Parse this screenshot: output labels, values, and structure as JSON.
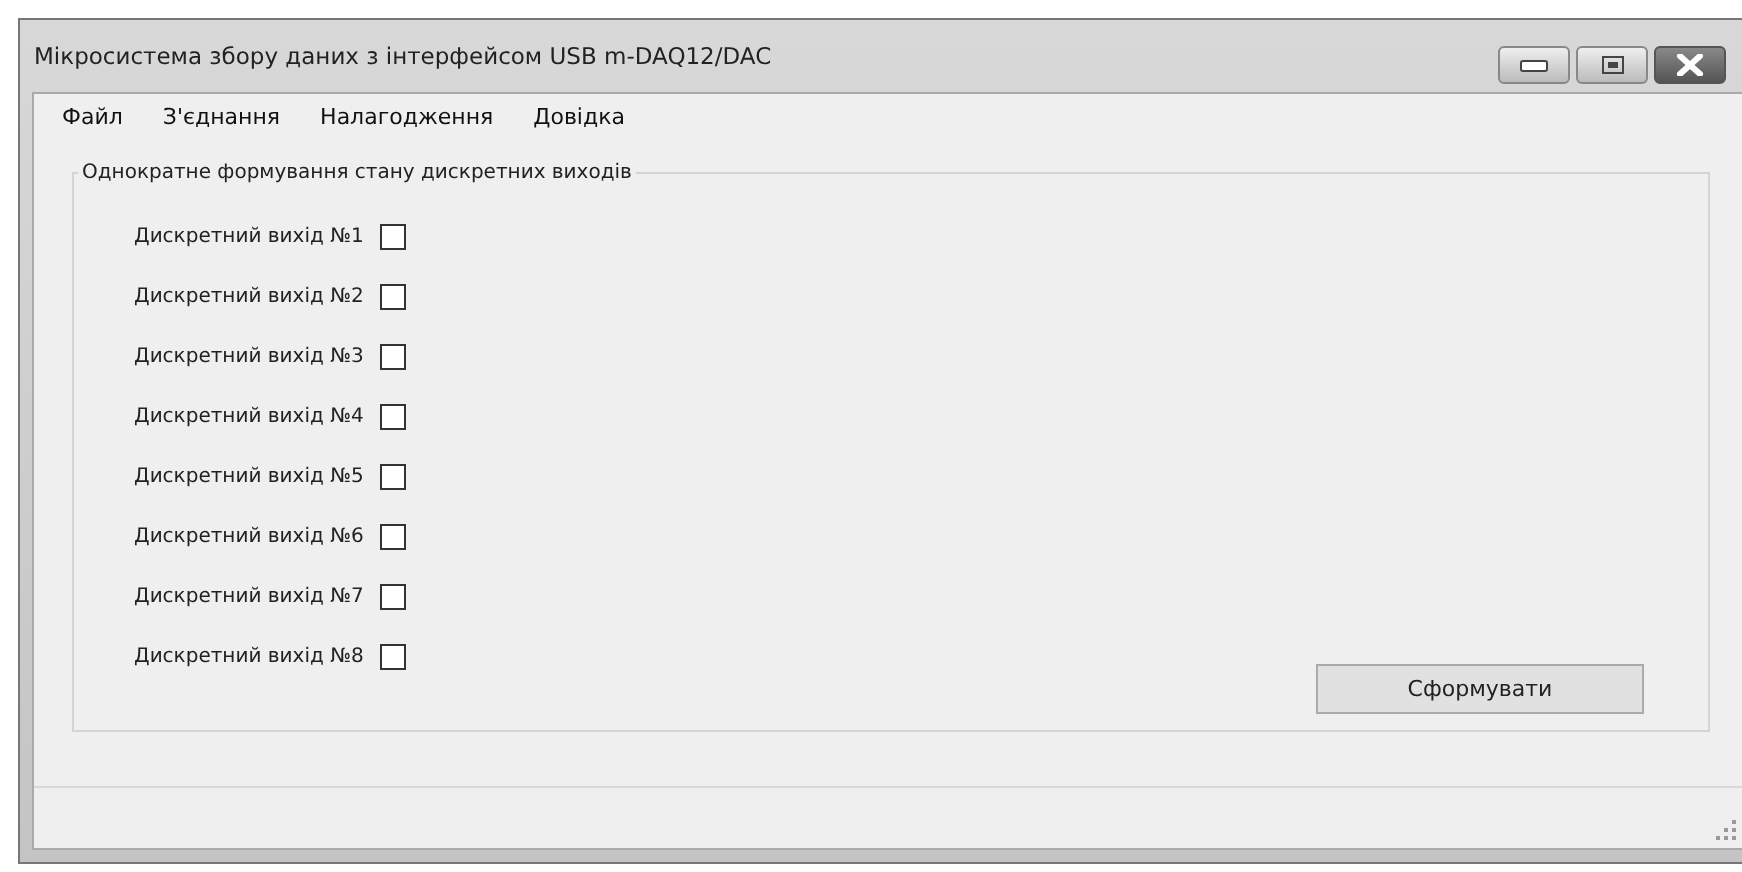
{
  "window": {
    "title": "Мікросистема збору даних з інтерфейсом USB m-DAQ12/DAC"
  },
  "menu": [
    "Файл",
    "З'єднання",
    "Налагодження",
    "Довідка"
  ],
  "group": {
    "title": "Однократне формування стану дискретних виходів",
    "outputs": [
      {
        "label": "Дискретний вихід №1",
        "checked": false
      },
      {
        "label": "Дискретний вихід №2",
        "checked": false
      },
      {
        "label": "Дискретний вихід №3",
        "checked": false
      },
      {
        "label": "Дискретний вихід №4",
        "checked": false
      },
      {
        "label": "Дискретний вихід №5",
        "checked": false
      },
      {
        "label": "Дискретний вихід №6",
        "checked": false
      },
      {
        "label": "Дискретний вихід №7",
        "checked": false
      },
      {
        "label": "Дискретний вихід №8",
        "checked": false
      }
    ],
    "button": "Сформувати"
  }
}
